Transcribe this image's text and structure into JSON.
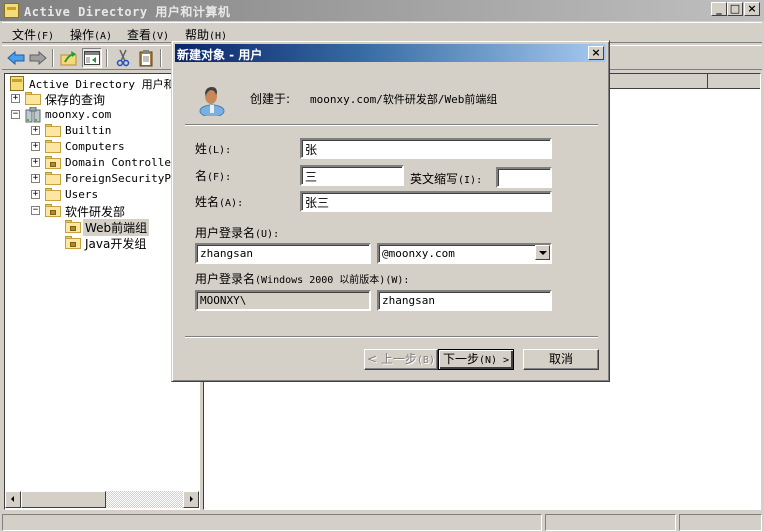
{
  "window": {
    "title": "Active Directory 用户和计算机",
    "controls": [
      "minimize",
      "maximize",
      "close"
    ]
  },
  "menubar": {
    "items": [
      {
        "label": "文件",
        "accel": "(F)"
      },
      {
        "label": "操作",
        "accel": "(A)"
      },
      {
        "label": "查看",
        "accel": "(V)"
      },
      {
        "label": "帮助",
        "accel": "(H)"
      }
    ]
  },
  "toolbar": {
    "buttons": [
      "back-arrow",
      "forward-arrow",
      "up-folder",
      "show-hide-console-tree",
      "cut",
      "paste"
    ]
  },
  "tree": {
    "root": "Active Directory 用户和计",
    "items": [
      {
        "label": "保存的查询",
        "expander": "+",
        "level": 1,
        "icon": "folder"
      },
      {
        "label": "moonxy.com",
        "expander": "-",
        "level": 1,
        "icon": "domain"
      },
      {
        "label": "Builtin",
        "expander": "+",
        "level": 2,
        "icon": "folder"
      },
      {
        "label": "Computers",
        "expander": "+",
        "level": 2,
        "icon": "folder"
      },
      {
        "label": "Domain Controllers",
        "expander": "+",
        "level": 2,
        "icon": "ou"
      },
      {
        "label": "ForeignSecurityPri",
        "expander": "+",
        "level": 2,
        "icon": "folder"
      },
      {
        "label": "Users",
        "expander": "+",
        "level": 2,
        "icon": "folder"
      },
      {
        "label": "软件研发部",
        "expander": "-",
        "level": 2,
        "icon": "ou"
      },
      {
        "label": "Web前端组",
        "expander": "",
        "level": 3,
        "icon": "ou",
        "selected": true
      },
      {
        "label": "Java开发组",
        "expander": "",
        "level": 3,
        "icon": "ou"
      }
    ]
  },
  "dialog": {
    "title": "新建对象 - 用户",
    "created_in_label": "创建于:",
    "created_in_path": "moonxy.com/软件研发部/Web前端组",
    "fields": {
      "last_name": {
        "label": "姓",
        "accel": "(L):",
        "value": "张"
      },
      "first_name": {
        "label": "名",
        "accel": "(F):",
        "value": "三"
      },
      "initials": {
        "label": "英文缩写",
        "accel": "(I):",
        "value": ""
      },
      "full_name": {
        "label": "姓名",
        "accel": "(A):",
        "value": "张三"
      },
      "logon_name": {
        "label": "用户登录名",
        "accel": "(U):",
        "value": "zhangsan"
      },
      "upn_suffix": {
        "value": "@moonxy.com"
      },
      "pre2000_label": {
        "label": "用户登录名",
        "accel": "(Windows 2000 以前版本)(W):"
      },
      "pre2000_domain": {
        "value": "MOONXY\\"
      },
      "pre2000_name": {
        "value": "zhangsan"
      }
    },
    "buttons": {
      "back": {
        "label": "< 上一步",
        "accel": "(B)"
      },
      "next": {
        "label": "下一步",
        "accel": "(N) >"
      },
      "cancel": {
        "label": "取消"
      }
    }
  }
}
